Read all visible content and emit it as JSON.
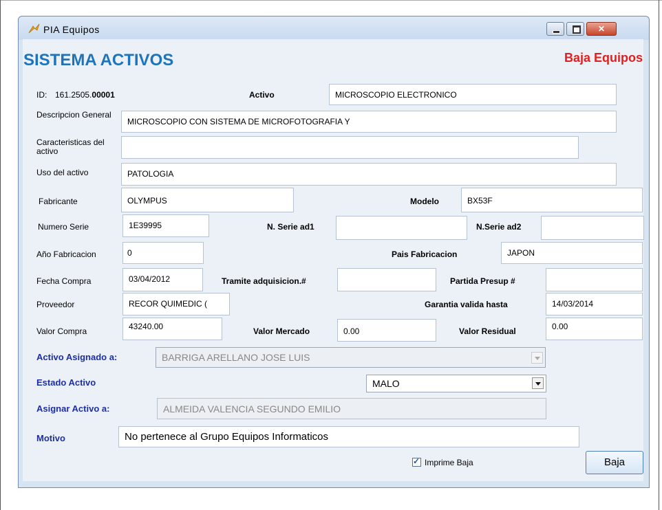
{
  "window": {
    "title": "PIA Equipos"
  },
  "header": {
    "system_title": "SISTEMA ACTIVOS",
    "page_title": "Baja Equipos"
  },
  "form": {
    "id_label": "ID:",
    "id_prefix": "161.2505.",
    "id_suffix": "00001",
    "activo_label": "Activo",
    "activo_value": "MICROSCOPIO ELECTRONICO",
    "descripcion_label": "Descripcion General",
    "descripcion_value": "MICROSCOPIO CON SISTEMA DE MICROFOTOGRAFIA Y",
    "caracteristicas_label": "Caracteristicas del activo",
    "caracteristicas_value": "",
    "uso_label": "Uso del activo",
    "uso_value": "PATOLOGIA",
    "fabricante_label": "Fabricante",
    "fabricante_value": "OLYMPUS",
    "modelo_label": "Modelo",
    "modelo_value": "BX53F",
    "numero_serie_label": "Numero Serie",
    "numero_serie_value": "1E39995",
    "serie_ad1_label": "N. Serie ad1",
    "serie_ad1_value": "",
    "serie_ad2_label": "N.Serie ad2",
    "serie_ad2_value": "",
    "anio_label": "Año Fabricacion",
    "anio_value": "0",
    "pais_label": "Pais Fabricacion",
    "pais_value": "JAPON",
    "fecha_label": "Fecha Compra",
    "fecha_value": "03/04/2012",
    "tramite_label": "Tramite adquisicion.#",
    "tramite_value": "",
    "partida_label": "Partida Presup #",
    "partida_value": "",
    "proveedor_label": "Proveedor",
    "proveedor_value": "RECOR QUIMEDIC (",
    "garantia_label": "Garantia valida hasta",
    "garantia_value": "14/03/2014",
    "valor_compra_label": "Valor Compra",
    "valor_compra_value": "43240.00",
    "valor_mercado_label": "Valor Mercado",
    "valor_mercado_value": "0.00",
    "valor_residual_label": "Valor Residual",
    "valor_residual_value": "0.00",
    "asignado_label": "Activo Asignado a:",
    "asignado_value": "BARRIGA ARELLANO JOSE LUIS",
    "estado_label": "Estado Activo",
    "estado_value": "MALO",
    "asignar_label": "Asignar Activo a:",
    "asignar_value": "ALMEIDA VALENCIA SEGUNDO EMILIO",
    "motivo_label": "Motivo",
    "motivo_value": "No pertenece al Grupo Equipos Informaticos",
    "imprime_label": "Imprime Baja",
    "imprime_checked": true,
    "baja_button": "Baja"
  },
  "colors": {
    "title_blue": "#1e73b9",
    "baja_red": "#e02020",
    "label_blue": "#1c2ea6"
  }
}
